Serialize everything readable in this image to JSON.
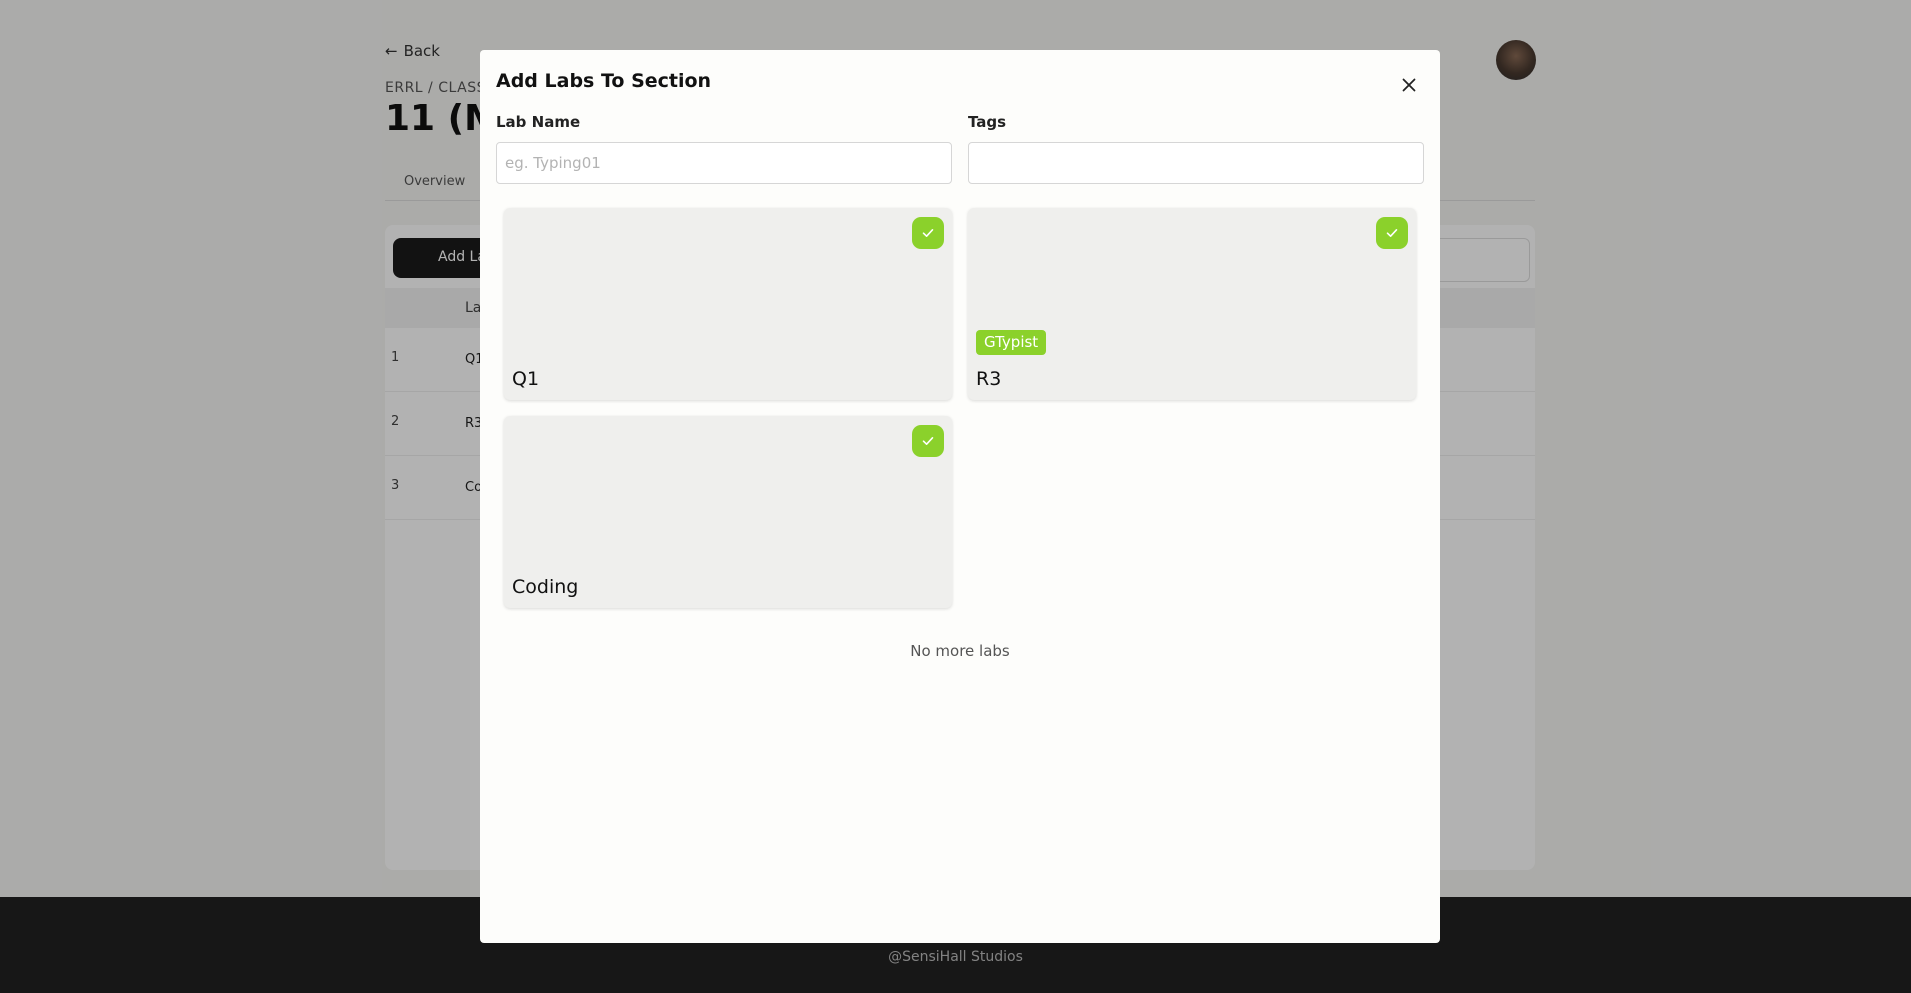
{
  "background": {
    "back_label": "Back",
    "breadcrumb": "ERRL / CLASS",
    "page_title": "11 (M",
    "tab_overview": "Overview",
    "add_button": "Add Lab",
    "table_header": "Lab",
    "rows": [
      {
        "num": "1",
        "text": "Q1"
      },
      {
        "num": "2",
        "text": "R3"
      },
      {
        "num": "3",
        "text": "Coding"
      }
    ],
    "footer_text": "@SensiHall Studios"
  },
  "modal": {
    "title": "Add Labs To Section",
    "lab_name_label": "Lab Name",
    "lab_name_placeholder": "eg. Typing01",
    "lab_name_value": "",
    "tags_label": "Tags",
    "tags_value": "",
    "labs": [
      {
        "name": "Q1",
        "tag": "",
        "selected": true
      },
      {
        "name": "R3",
        "tag": "GTypist",
        "selected": true
      },
      {
        "name": "Coding",
        "tag": "",
        "selected": true
      }
    ],
    "empty_message": "No more labs"
  },
  "colors": {
    "accent_green": "#8bd12b",
    "modal_bg": "#fdfdfb",
    "card_bg": "#efefed",
    "overlay": "rgba(0,0,0,0.30)"
  },
  "icons": {
    "close": "close-icon",
    "check": "check-icon",
    "back": "arrow-left-icon"
  }
}
